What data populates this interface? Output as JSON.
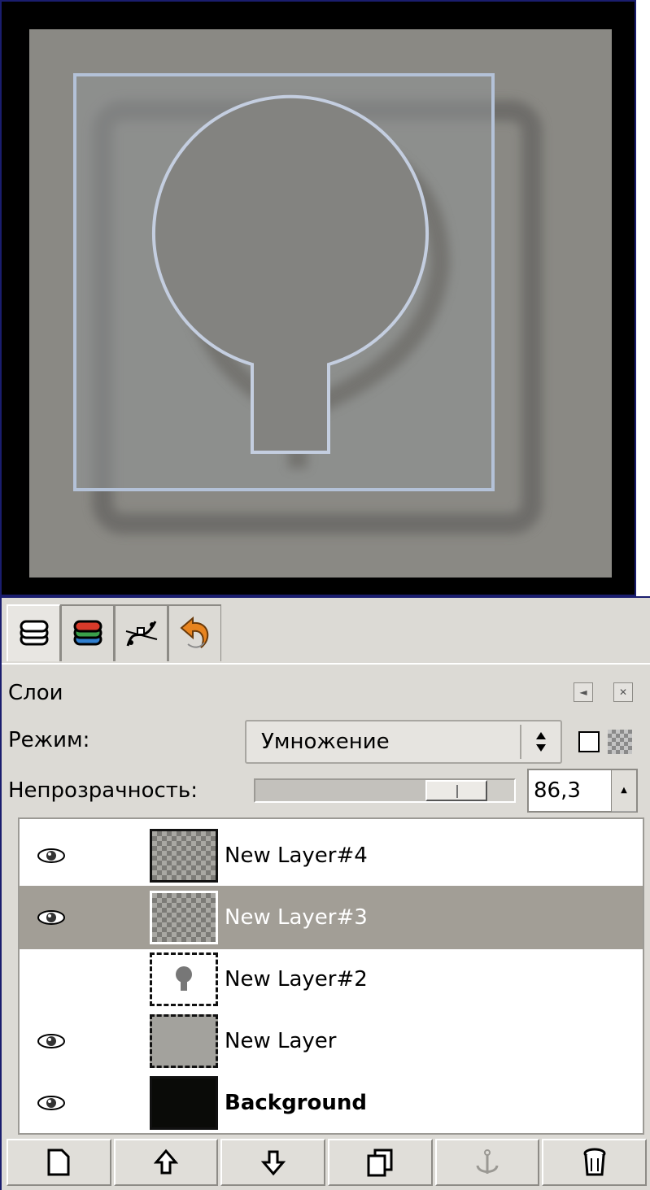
{
  "canvas": {
    "background_color": "#8a8984",
    "frame_color": "#000000",
    "outline_color": "#b4c2d8"
  },
  "dock": {
    "tabs": [
      {
        "icon": "layers-icon",
        "active": true
      },
      {
        "icon": "channels-icon",
        "active": false
      },
      {
        "icon": "paths-icon",
        "active": false
      },
      {
        "icon": "undo-history-icon",
        "active": false
      }
    ],
    "title": "Слои"
  },
  "mode": {
    "label": "Режим:",
    "value": "Умножение"
  },
  "opacity": {
    "label": "Непрозрачность:",
    "value": "86,3",
    "level": 0.863
  },
  "layers": [
    {
      "name": "New Layer#4",
      "visible": true,
      "selected": false,
      "bold": false
    },
    {
      "name": "New Layer#3",
      "visible": true,
      "selected": true,
      "bold": false
    },
    {
      "name": "New Layer#2",
      "visible": false,
      "selected": false,
      "bold": false
    },
    {
      "name": "New Layer",
      "visible": true,
      "selected": false,
      "bold": false
    },
    {
      "name": "Background",
      "visible": true,
      "selected": false,
      "bold": true
    }
  ],
  "buttons": [
    "new-layer-icon",
    "raise-layer-icon",
    "lower-layer-icon",
    "duplicate-layer-icon",
    "anchor-layer-icon",
    "delete-layer-icon"
  ]
}
